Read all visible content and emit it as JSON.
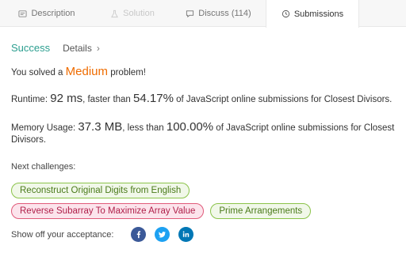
{
  "tabs": [
    {
      "label": "Description",
      "icon": "description-icon",
      "state": "normal"
    },
    {
      "label": "Solution",
      "icon": "flask-icon",
      "state": "disabled"
    },
    {
      "label": "Discuss (114)",
      "icon": "discuss-icon",
      "state": "normal"
    },
    {
      "label": "Submissions",
      "icon": "clock-icon",
      "state": "active"
    }
  ],
  "status": {
    "label": "Success",
    "details_label": "Details",
    "details_chevron": "›"
  },
  "solved": {
    "prefix": "You solved a",
    "difficulty": "Medium",
    "suffix": "problem!",
    "difficulty_color": "#ef6c00"
  },
  "runtime": {
    "label": "Runtime:",
    "value": "92 ms",
    "mid": ", faster than",
    "percent": "54.17%",
    "suffix": "of JavaScript online submissions for Closest Divisors."
  },
  "memory": {
    "label": "Memory Usage:",
    "value": "37.3 MB",
    "mid": ", less than",
    "percent": "100.00%",
    "suffix": "of JavaScript online submissions for Closest",
    "suffix_line2": "Divisors."
  },
  "next": {
    "label": "Next challenges:",
    "row1": [
      {
        "label": "Reconstruct Original Digits from English",
        "difficulty": "medium"
      }
    ],
    "row2": [
      {
        "label": "Reverse Subarray To Maximize Array Value",
        "difficulty": "hard"
      },
      {
        "label": "Prime Arrangements",
        "difficulty": "easy"
      }
    ]
  },
  "share": {
    "label": "Show off your acceptance:",
    "networks": [
      "facebook-icon",
      "twitter-icon",
      "linkedin-icon"
    ]
  },
  "colors": {
    "success": "#2b9e8f",
    "medium": "#8bc34a",
    "hard": "#e05a7a",
    "facebook": "#3b5998",
    "twitter": "#1da1f2",
    "linkedin": "#0077b5"
  }
}
